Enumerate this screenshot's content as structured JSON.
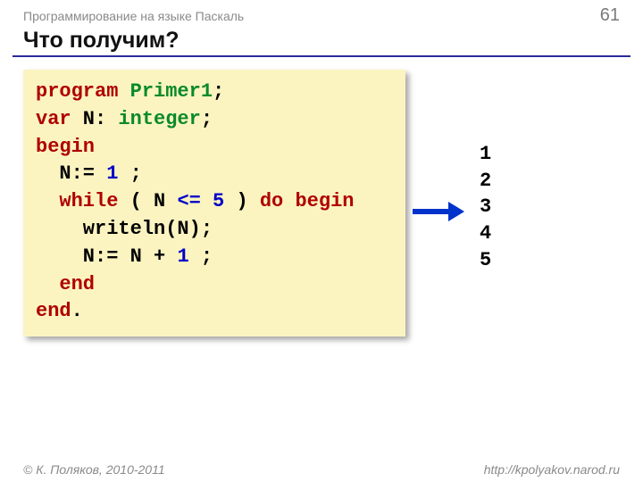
{
  "header": {
    "subject": "Программирование на языке Паскаль",
    "page_number": "61"
  },
  "title": "Что получим?",
  "code": {
    "line1": {
      "kw_program": "program",
      "name": "Primer1",
      "semi": ";"
    },
    "line2": {
      "kw_var": "var",
      "decl1": " N: ",
      "kw_int": "integer",
      "semi": ";"
    },
    "line3": {
      "kw_begin": "begin"
    },
    "line4": {
      "indent": "  N:= ",
      "num": "1",
      "semi": " ;"
    },
    "line5": {
      "indent": "  ",
      "kw_while": "while",
      "paren1": " ( N ",
      "op": "<=",
      "sp": " ",
      "num": "5",
      "paren2": " ) ",
      "kw_do": "do",
      "sp2": " ",
      "kw_begin": "begin"
    },
    "line6": {
      "text": "    writeln(N);"
    },
    "line7": {
      "text1": "    N:= N + ",
      "num": "1",
      "semi": " ;"
    },
    "line8": {
      "indent": "  ",
      "kw_end": "end"
    },
    "line9": {
      "kw_end": "end",
      "dot": "."
    }
  },
  "output": "1\n2\n3\n4\n5",
  "footer": {
    "copyright": "© К. Поляков, 2010-2011",
    "url": "http://kpolyakov.narod.ru"
  }
}
